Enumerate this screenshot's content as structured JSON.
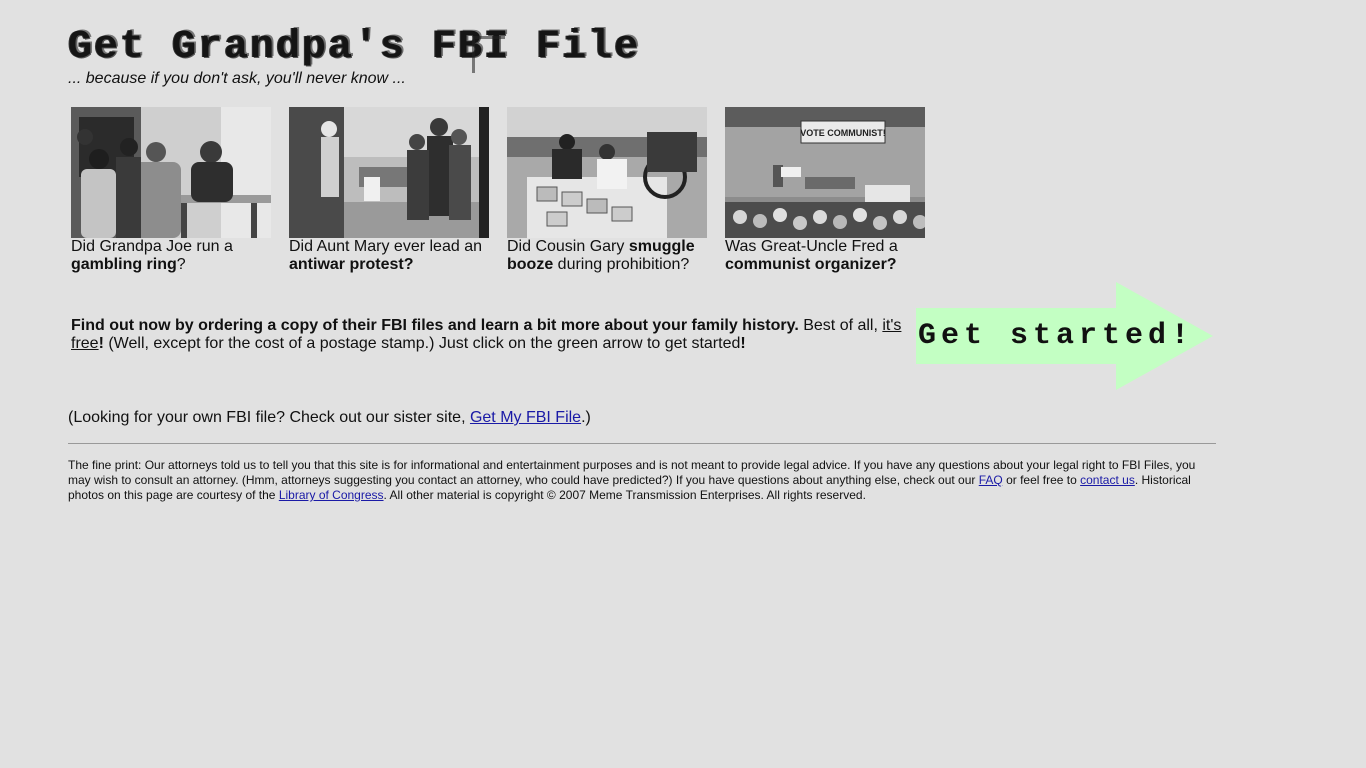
{
  "header": {
    "title": "Get Grandpa's FBI File",
    "tagline": "... because if you don't ask, you'll never know ..."
  },
  "gallery": [
    {
      "pre": "Did Grandpa Joe run a ",
      "bold": "gambling ring",
      "post": "?",
      "photo": "card-game-photo"
    },
    {
      "pre": "Did Aunt Mary ever lead an ",
      "bold": "antiwar protest?",
      "post": "",
      "photo": "protest-photo"
    },
    {
      "pre": "Did Cousin Gary ",
      "bold": "smuggle booze",
      "post": " during prohibition?",
      "photo": "bootleg-photo"
    },
    {
      "pre": "Was Great-Uncle Fred a ",
      "bold": "communist organizer?",
      "post": "",
      "photo": "rally-photo"
    }
  ],
  "photo_signs": {
    "rally_banner": "VOTE COMMUNIST!"
  },
  "cta": {
    "lead_bold": "Find out now by ordering a copy of their FBI files and learn a bit more about your family history.",
    "middle": " Best of all, ",
    "free_link": "it's free",
    "free_bang": "!",
    "rest": " (Well, except for the cost of a postage stamp.) Just click on the green arrow to get started",
    "end_bang": "!",
    "arrow_label": "Get started!",
    "arrow_color": "#c3ffc3"
  },
  "sister": {
    "pre": "(Looking for your own FBI file? Check out our sister site, ",
    "link": "Get My FBI File",
    "post": ".)"
  },
  "fineprint": {
    "text1": "The fine print: Our attorneys told us to tell you that this site is for informational and entertainment purposes and is not meant to provide legal advice. If you have any questions about your legal right to FBI Files, you may wish to consult an attorney. (Hmm, attorneys suggesting you contact an attorney, who could have predicted?) If you have questions about anything else, check out our ",
    "faq_link": "FAQ",
    "text2": " or feel free to ",
    "contact_link": "contact us",
    "text3": ". Historical photos on this page are courtesy of the ",
    "loc_link": "Library of Congress",
    "text4": ". All other material is copyright © 2007 Meme Transmission Enterprises. All rights reserved."
  },
  "colors": {
    "background": "#e1e1e1",
    "link": "#1a1aa6",
    "arrow": "#c3ffc3"
  }
}
